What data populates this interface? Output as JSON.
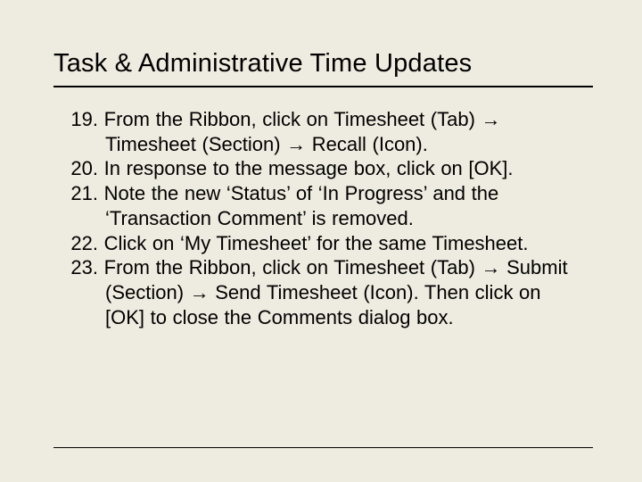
{
  "title": "Task & Administrative Time Updates",
  "steps": [
    {
      "n": "19.",
      "text": "From the Ribbon, click on Timesheet (Tab) → Timesheet (Section) → Recall (Icon)."
    },
    {
      "n": "20.",
      "text": "In response to the message box, click on [OK]."
    },
    {
      "n": "21.",
      "text": "Note the new ‘Status’ of ‘In Progress’ and the ‘Transaction Comment’ is removed."
    },
    {
      "n": "22.",
      "text": "Click on ‘My Timesheet’ for the same Timesheet."
    },
    {
      "n": "23.",
      "text": "From the Ribbon, click on Timesheet (Tab) → Submit (Section) → Send Timesheet (Icon). Then click on [OK] to close the Comments dialog box."
    }
  ]
}
